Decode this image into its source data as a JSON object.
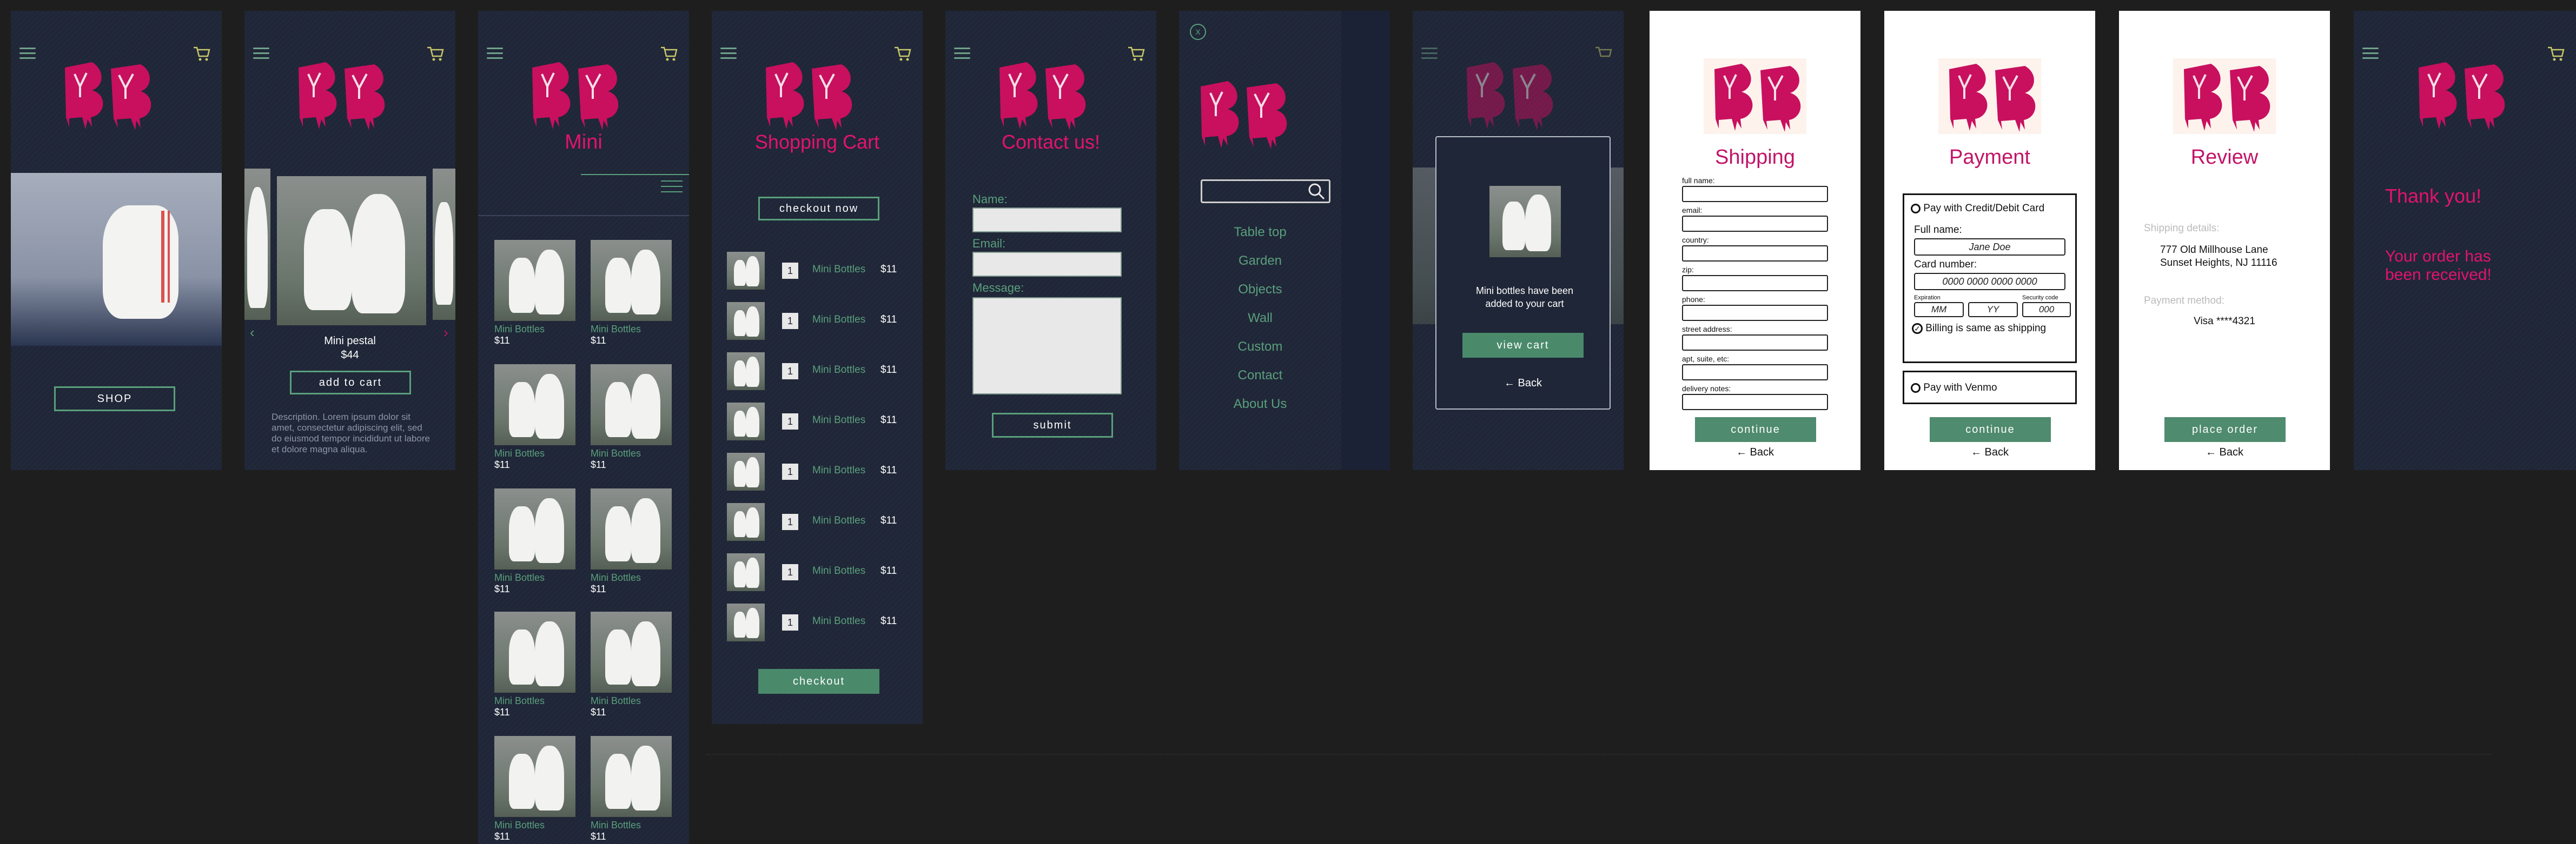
{
  "shop": {
    "button": "SHOP"
  },
  "product": {
    "name": "Mini pestal",
    "price": "$44",
    "add_to_cart": "add to cart",
    "description": "Description. Lorem ipsum dolor sit amet, consectetur adipiscing elit, sed do eiusmod tempor incididunt ut labore et dolore magna aliqua."
  },
  "catalog": {
    "title": "Mini",
    "items": [
      {
        "label": "Mini Bottles",
        "price": "$11"
      },
      {
        "label": "Mini Bottles",
        "price": "$11"
      },
      {
        "label": "Mini Bottles",
        "price": "$11"
      },
      {
        "label": "Mini Bottles",
        "price": "$11"
      },
      {
        "label": "Mini Bottles",
        "price": "$11"
      },
      {
        "label": "Mini Bottles",
        "price": "$11"
      },
      {
        "label": "Mini Bottles",
        "price": "$11"
      },
      {
        "label": "Mini Bottles",
        "price": "$11"
      },
      {
        "label": "Mini Bottles",
        "price": "$11"
      },
      {
        "label": "Mini Bottles",
        "price": "$11"
      }
    ]
  },
  "cart": {
    "title": "Shopping Cart",
    "checkout_now": "checkout now",
    "checkout": "checkout",
    "rows": [
      {
        "qty": "1",
        "name": "Mini Bottles",
        "price": "$11"
      },
      {
        "qty": "1",
        "name": "Mini Bottles",
        "price": "$11"
      },
      {
        "qty": "1",
        "name": "Mini Bottles",
        "price": "$11"
      },
      {
        "qty": "1",
        "name": "Mini Bottles",
        "price": "$11"
      },
      {
        "qty": "1",
        "name": "Mini Bottles",
        "price": "$11"
      },
      {
        "qty": "1",
        "name": "Mini Bottles",
        "price": "$11"
      },
      {
        "qty": "1",
        "name": "Mini Bottles",
        "price": "$11"
      },
      {
        "qty": "1",
        "name": "Mini Bottles",
        "price": "$11"
      }
    ]
  },
  "contact": {
    "title": "Contact us!",
    "name_label": "Name:",
    "email_label": "Email:",
    "message_label": "Message:",
    "submit": "submit"
  },
  "menu": {
    "close": "X",
    "items": [
      "Table top",
      "Garden",
      "Objects",
      "Wall",
      "Custom",
      "Contact",
      "About Us"
    ]
  },
  "added": {
    "message": "Mini bottles have been added to your cart",
    "view_cart": "view cart",
    "back": "Back"
  },
  "shipping": {
    "title": "Shipping",
    "fields": [
      "full name:",
      "email:",
      "country:",
      "zip:",
      "phone:",
      "street address:",
      "apt, suite, etc:",
      "delivery notes:"
    ],
    "continue": "continue",
    "back": "Back"
  },
  "payment": {
    "title": "Payment",
    "card_option": "Pay with Credit/Debit Card",
    "full_name_label": "Full name:",
    "full_name_value": "Jane Doe",
    "card_label": "Card number:",
    "card_value": "0000 0000 0000 0000",
    "exp_label": "Expiration",
    "security_label": "Security code",
    "mm": "MM",
    "yy": "YY",
    "code": "000",
    "billing": "Billing is same as shipping",
    "venmo": "Pay with Venmo",
    "continue": "continue",
    "back": "Back"
  },
  "review": {
    "title": "Review",
    "shipping_label": "Shipping details:",
    "address1": "777 Old Millhouse Lane",
    "address2": "Sunset Heights, NJ 11116",
    "payment_label": "Payment method:",
    "payment_value": "Visa ****4321",
    "place_order": "place order",
    "back": "Back"
  },
  "thanks": {
    "title": "Thank you!",
    "message": "Your order has been received!"
  },
  "colors": {
    "brand": "#e2136e",
    "accent": "#5a9f7d",
    "bg": "#1f2637",
    "canvas": "#1e1e1e"
  }
}
